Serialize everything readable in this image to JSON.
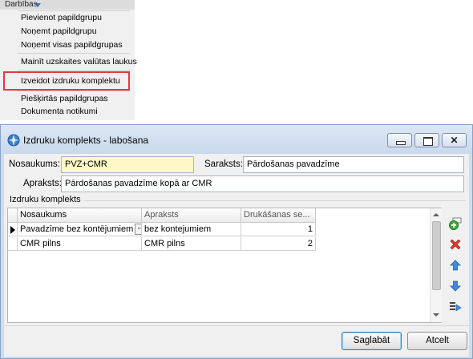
{
  "menu": {
    "header": "Darbības",
    "items": [
      "Pievienot papildgrupu",
      "Noņemt papildgrupu",
      "Noņemt visas papildgrupas",
      "Mainīt uzskaites valūtas laukus",
      "Izveidot izdruku komplektu",
      "Piešķirtās papildgrupas",
      "Dokumenta notikumi"
    ],
    "highlighted_item": "Izveidot izdruku komplektu",
    "highlight_color": "#e0393e"
  },
  "dialog": {
    "title": "Izdruku komplekts - labošana",
    "close_glyph": "✕",
    "fields": {
      "nosaukums_label": "Nosaukums:",
      "nosaukums_value": "PVZ+CMR",
      "saraksts_label": "Saraksts:",
      "saraksts_value": "Pārdošanas pavadzīme",
      "apraksts_label": "Apraksts:",
      "apraksts_value": "Pārdošanas pavadzīme kopā ar CMR"
    },
    "group_label": "Izdruku komplekts",
    "grid": {
      "columns": [
        "Nosaukums",
        "Apraksts",
        "Drukāšanas se..."
      ],
      "rows": [
        {
          "name": "Pavadzīme bez kontējumiem",
          "description": "bez kontejumiem",
          "order": "1",
          "current": true
        },
        {
          "name": "CMR pilns",
          "description": "CMR pilns",
          "order": "2",
          "current": false
        }
      ],
      "ellipsis": "···"
    },
    "tools": [
      "add-icon",
      "delete-icon",
      "move-up-icon",
      "move-down-icon",
      "assign-icon"
    ],
    "buttons": {
      "save": "Saglabāt",
      "cancel": "Atcelt"
    },
    "colors": {
      "titlebar": "#c9d9ec",
      "required_field": "#fdf8c5"
    }
  }
}
